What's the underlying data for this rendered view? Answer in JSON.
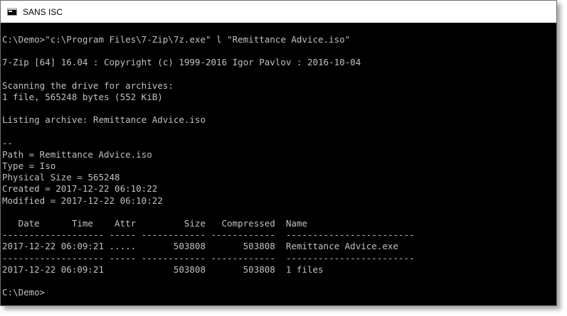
{
  "window": {
    "title": "SANS ISC"
  },
  "console": {
    "lines": [
      "C:\\Demo>\"c:\\Program Files\\7-Zip\\7z.exe\" l \"Remittance Advice.iso\"",
      "",
      "7-Zip [64] 16.04 : Copyright (c) 1999-2016 Igor Pavlov : 2016-10-04",
      "",
      "Scanning the drive for archives:",
      "1 file, 565248 bytes (552 KiB)",
      "",
      "Listing archive: Remittance Advice.iso",
      "",
      "--",
      "Path = Remittance Advice.iso",
      "Type = Iso",
      "Physical Size = 565248",
      "Created = 2017-12-22 06:10:22",
      "Modified = 2017-12-22 06:10:22",
      "",
      "   Date      Time    Attr         Size   Compressed  Name",
      "------------------- ----- ------------ ------------  ------------------------",
      "2017-12-22 06:09:21 .....       503808       503808  Remittance Advice.exe",
      "------------------- ----- ------------ ------------  ------------------------",
      "2017-12-22 06:09:21             503808       503808  1 files",
      "",
      "C:\\Demo>"
    ]
  },
  "colors": {
    "console_background": "#000000",
    "console_text": "#c0c0c0",
    "titlebar_background": "#ffffff"
  },
  "icons": {
    "app_icon": "console-icon"
  }
}
